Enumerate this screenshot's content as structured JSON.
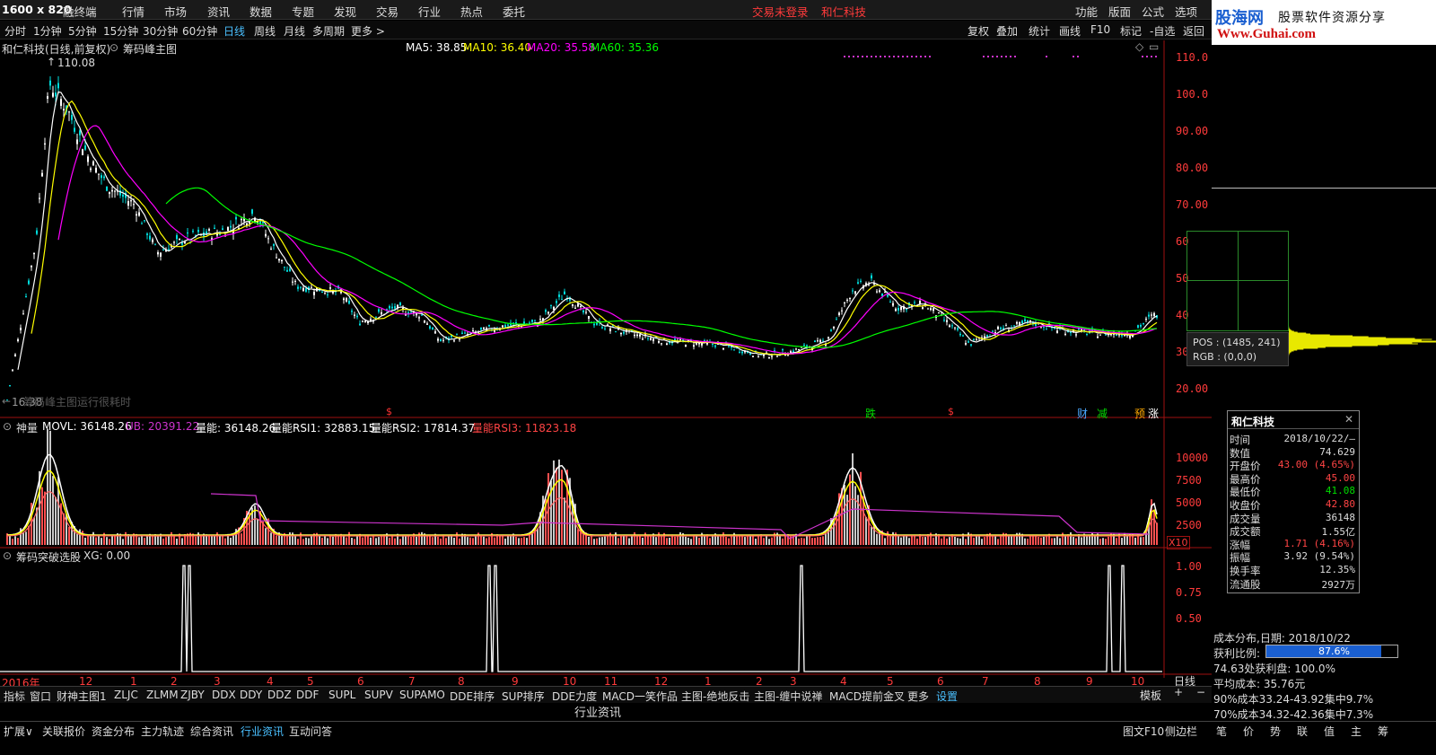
{
  "window": {
    "size_label": "1600 x 820",
    "title_partial": "融终端"
  },
  "menu": {
    "items": [
      "行情",
      "市场",
      "资讯",
      "数据",
      "专题",
      "发现",
      "交易",
      "行业",
      "热点",
      "委托"
    ],
    "trade_status": "交易未登录",
    "stock_name": "和仁科技",
    "right_items": [
      "功能",
      "版面",
      "公式",
      "选项"
    ]
  },
  "brand": {
    "logo": "股海网",
    "slogan": "股票软件资源分享",
    "url": "Www.Guhai.com"
  },
  "periods": {
    "items": [
      "分时",
      "1分钟",
      "5分钟",
      "15分钟",
      "30分钟",
      "60分钟",
      "日线",
      "周线",
      "月线",
      "多周期",
      "更多 >"
    ],
    "selected": "日线"
  },
  "toolbar_right": [
    "复权",
    "叠加",
    "统计",
    "画线",
    "F10",
    "标记",
    "-自选",
    "返回"
  ],
  "main_chart": {
    "title": "和仁科技(日线,前复权)",
    "indicator": "筹码峰主图",
    "ma": [
      {
        "label": "MA5: 38.85",
        "color": "#ffffff"
      },
      {
        "label": "MA10: 36.40",
        "color": "#ffff00"
      },
      {
        "label": "MA20: 35.58",
        "color": "#ff00ff"
      },
      {
        "label": "MA60: 35.36",
        "color": "#00ff00"
      }
    ],
    "high_label": "110.08",
    "low_label": "16.38",
    "notice": "筹码峰主图运行很耗时",
    "y_ticks": [
      "110.0",
      "100.0",
      "90.00",
      "80.00",
      "70.00",
      "60",
      "50",
      "40",
      "30",
      "20.00"
    ],
    "markers": [
      {
        "text": "$",
        "color": "#ff3333"
      },
      {
        "text": "跌",
        "color": "#00dd00"
      },
      {
        "text": "$",
        "color": "#ff3333"
      },
      {
        "text": "财",
        "color": "#4aa8ff"
      },
      {
        "text": "减",
        "color": "#00dd00"
      },
      {
        "text": "预",
        "color": "#ffaa00"
      },
      {
        "text": "涨",
        "color": "#ffffff"
      }
    ]
  },
  "vol_panel": {
    "name": "神量",
    "items": [
      {
        "label": "MOVL: 36148.26",
        "color": "#ffffff"
      },
      {
        "label": "UB: 20391.22",
        "color": "#cc33cc"
      },
      {
        "label": "量能: 36148.26",
        "color": "#ffffff"
      },
      {
        "label": "量能RSI1: 32883.15",
        "color": "#ffffff"
      },
      {
        "label": "量能RSI2: 17814.37",
        "color": "#ffffff"
      },
      {
        "label": "量能RSI3: 11823.18",
        "color": "#ff4444"
      }
    ],
    "y_ticks": [
      "10000",
      "7500",
      "5000",
      "2500"
    ],
    "unit": "X10"
  },
  "xg_panel": {
    "name": "筹码突破选股",
    "label": "XG: 0.00",
    "y_ticks": [
      "1.00",
      "0.75",
      "0.50"
    ]
  },
  "x_axis": {
    "labels": [
      "2016年",
      "12",
      "1",
      "2",
      "3",
      "4",
      "5",
      "6",
      "7",
      "8",
      "9",
      "10",
      "11",
      "12",
      "1",
      "2",
      "3",
      "4",
      "5",
      "6",
      "7",
      "8",
      "9",
      "10"
    ],
    "period": "日线"
  },
  "crosshair": {
    "pos": "POS : (1485, 241)",
    "rgb": "RGB : (0,0,0)"
  },
  "infobox": {
    "title": "和仁科技",
    "rows": [
      {
        "k": "时间",
        "v": "2018/10/22/—",
        "c": "#dddddd"
      },
      {
        "k": "数值",
        "v": "74.629",
        "c": "#dddddd"
      },
      {
        "k": "开盘价",
        "v": "43.00 (4.65%)",
        "c": "#ff4444"
      },
      {
        "k": "最高价",
        "v": "45.00",
        "c": "#ff4444"
      },
      {
        "k": "最低价",
        "v": "41.08",
        "c": "#00dd00"
      },
      {
        "k": "收盘价",
        "v": "42.80",
        "c": "#ff4444"
      },
      {
        "k": "成交量",
        "v": "36148",
        "c": "#dddddd"
      },
      {
        "k": "成交额",
        "v": "1.55亿",
        "c": "#dddddd"
      },
      {
        "k": "涨幅",
        "v": "1.71 (4.16%)",
        "c": "#ff4444"
      },
      {
        "k": "振幅",
        "v": "3.92 (9.54%)",
        "c": "#dddddd"
      },
      {
        "k": "换手率",
        "v": "12.35%",
        "c": "#dddddd"
      },
      {
        "k": "流通股",
        "v": "2927万",
        "c": "#dddddd"
      }
    ]
  },
  "cost": {
    "title": "成本分布,日期: 2018/10/22",
    "profit_label": "获利比例:",
    "profit_value": "87.6%",
    "profit_fraction": 0.876,
    "rows": [
      "74.63处获利盘: 100.0%",
      "平均成本: 35.76元",
      "90%成本33.24-43.92集中9.7%",
      "70%成本34.32-42.36集中7.3%"
    ]
  },
  "bottom_tabs": {
    "items": [
      "指标",
      "窗口",
      "财神主图1",
      "ZLJC",
      "ZLMM",
      "ZJBY",
      "DDX",
      "DDY",
      "DDZ",
      "DDF",
      "SUPL",
      "SUPV",
      "SUPAMO",
      "DDE排序",
      "SUP排序",
      "DDE力度",
      "MACD一笑作品",
      "主图-绝地反击",
      "主图-缠中说禅",
      "MACD提前金叉",
      "更多",
      "设置"
    ],
    "selected": "设置",
    "template": "模板"
  },
  "news_label": "行业资讯",
  "status_tabs": [
    "扩展∨",
    "关联报价",
    "资金分布",
    "主力轨迹",
    "综合资讯",
    "行业资讯",
    "互动问答"
  ],
  "status_selected": "行业资讯",
  "status_right": [
    "图文F10",
    "侧边栏"
  ],
  "side_tabs": [
    "笔",
    "价",
    "势",
    "联",
    "值",
    "主",
    "筹"
  ]
}
